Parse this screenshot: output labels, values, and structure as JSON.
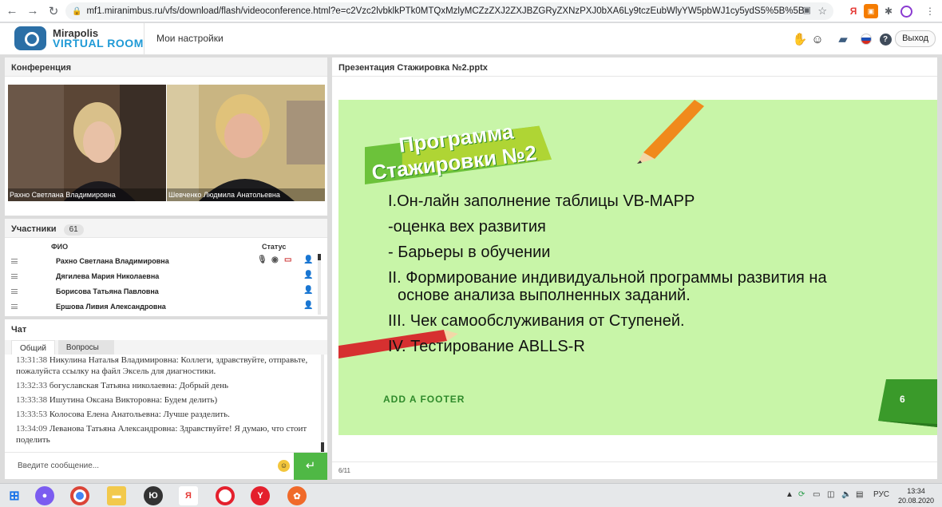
{
  "browser": {
    "url": "mf1.miranimbus.ru/vfs/download/flash/videoconference.html?e=c2Vzc2lvbklkPTk0MTQxMzlyMCZzZXJ2ZXJBZGRyZXNzPXJ0bXA6Ly9tczEubWlyYW5pbWJ1cy5ydS5%5B%5BdToxOTM1L3Zpc..."
  },
  "app": {
    "logo_line1": "Mirapolis",
    "logo_line2": "VIRTUAL ROOM",
    "settings_label": "Мои настройки",
    "exit_label": "Выход"
  },
  "conference": {
    "title": "Конференция",
    "videos": [
      {
        "name": "Рахно Светлана Владимировна"
      },
      {
        "name": "Шевченко  Людмила  Анатольевна"
      }
    ]
  },
  "participants": {
    "title": "Участники",
    "count": "61",
    "col_name": "ФИО",
    "col_status": "Статус",
    "rows": [
      {
        "name": "Рахно Светлана Владимировна"
      },
      {
        "name": "Дягилева Мария Николаевна"
      },
      {
        "name": "Борисова  Татьяна  Павловна"
      },
      {
        "name": "Ершова  Ливия  Александровна"
      }
    ]
  },
  "chat": {
    "title": "Чат",
    "tab_general": "Общий",
    "tab_questions": "Вопросы",
    "messages": [
      {
        "time": "13:31:38",
        "text": "Никулина Наталья Владимировна: Коллеги, здравствуйте, отправьте, пожалуйста ссылку на файл Эксель для диагностики."
      },
      {
        "time": "13:32:33",
        "text": "богуславская  Татьяна  николаевна: Добрый день"
      },
      {
        "time": "13:33:38",
        "text": "Ишутина Оксана Викторовна: Будем делить)"
      },
      {
        "time": "13:33:53",
        "text": "Колосова Елена  Анатольевна: Лучше разделить."
      },
      {
        "time": "13:34:09",
        "text": "Леванова Татьяна  Александровна: Здравствуйте! Я думаю, что стоит поделить"
      }
    ],
    "input_placeholder": "Введите сообщение..."
  },
  "presentation": {
    "title": "Презентация Стажировка №2.pptx",
    "banner_line1": "Программа",
    "banner_line2": "Стажировки №2",
    "lines": [
      "I.Он-лайн заполнение таблицы VB-MAPP",
      "-оценка вех развития",
      "- Барьеры в обучении",
      "II. Формирование индивидуальной программы развития на",
      "основе анализа выполненных заданий.",
      "III. Чек самообслуживания от Ступеней.",
      "IV. Тестирование ABLLS-R"
    ],
    "footer": "ADD A FOOTER",
    "slide_number": "6",
    "page_counter": "6/11"
  },
  "taskbar": {
    "lang": "РУС",
    "time": "13:34",
    "date": "20.08.2020"
  },
  "colors": {
    "accent_green": "#4fb845",
    "slide_bg": "#c8f5a8",
    "brand_blue": "#1f9ad6"
  }
}
